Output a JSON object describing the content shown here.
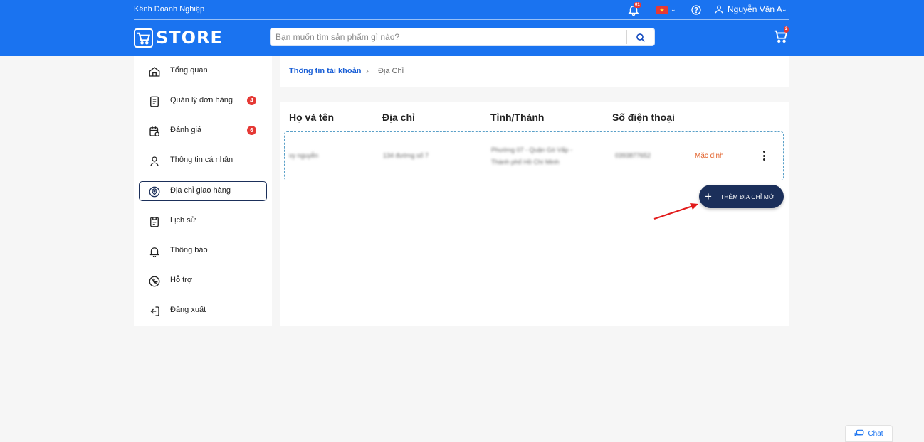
{
  "header": {
    "business_channel": "Kênh Doanh Nghiệp",
    "notification_badge": "01",
    "language_flag": "vietnam-flag",
    "user_name": "Nguyễn Văn A",
    "logo_text": "STORE",
    "search_placeholder": "Bạn muốn tìm sản phẩm gì nào?",
    "cart_badge": "2",
    "brand_color": "#1a73f0"
  },
  "sidebar": {
    "items": [
      {
        "label": "Tổng quan",
        "icon": "home-icon"
      },
      {
        "label": "Quản lý đơn hàng",
        "icon": "receipt-icon",
        "badge": "4"
      },
      {
        "label": "Đánh giá",
        "icon": "calendar-review-icon",
        "badge": "6"
      },
      {
        "label": "Thông tin cá nhân",
        "icon": "user-icon"
      },
      {
        "label": "Địa chỉ giao hàng",
        "icon": "location-pin-icon",
        "active": true
      },
      {
        "label": "Lịch sử",
        "icon": "history-icon"
      },
      {
        "label": "Thông báo",
        "icon": "bell-icon"
      },
      {
        "label": "Hỗ trợ",
        "icon": "support-phone-icon"
      },
      {
        "label": "Đăng xuất",
        "icon": "logout-icon"
      }
    ]
  },
  "breadcrumb": {
    "parent": "Thông tin tài khoản",
    "current": "Địa Chỉ"
  },
  "address_table": {
    "columns": [
      "Họ và tên",
      "Địa chỉ",
      "Tỉnh/Thành",
      "Số điện thoại"
    ],
    "rows": [
      {
        "name": "vy nguyễn",
        "address": "134 đường số 7",
        "province_line1": "Phường 07 - Quận Gò Vấp -",
        "province_line2": "Thành phố Hồ Chí Minh",
        "phone": "0393877652",
        "tag": "Mặc định"
      }
    ],
    "add_button_label": "THÊM ĐỊA CHỈ MỚI",
    "accent_color": "#1b2f5a",
    "default_tag_color": "#e2622b"
  },
  "chat": {
    "label": "Chat"
  }
}
